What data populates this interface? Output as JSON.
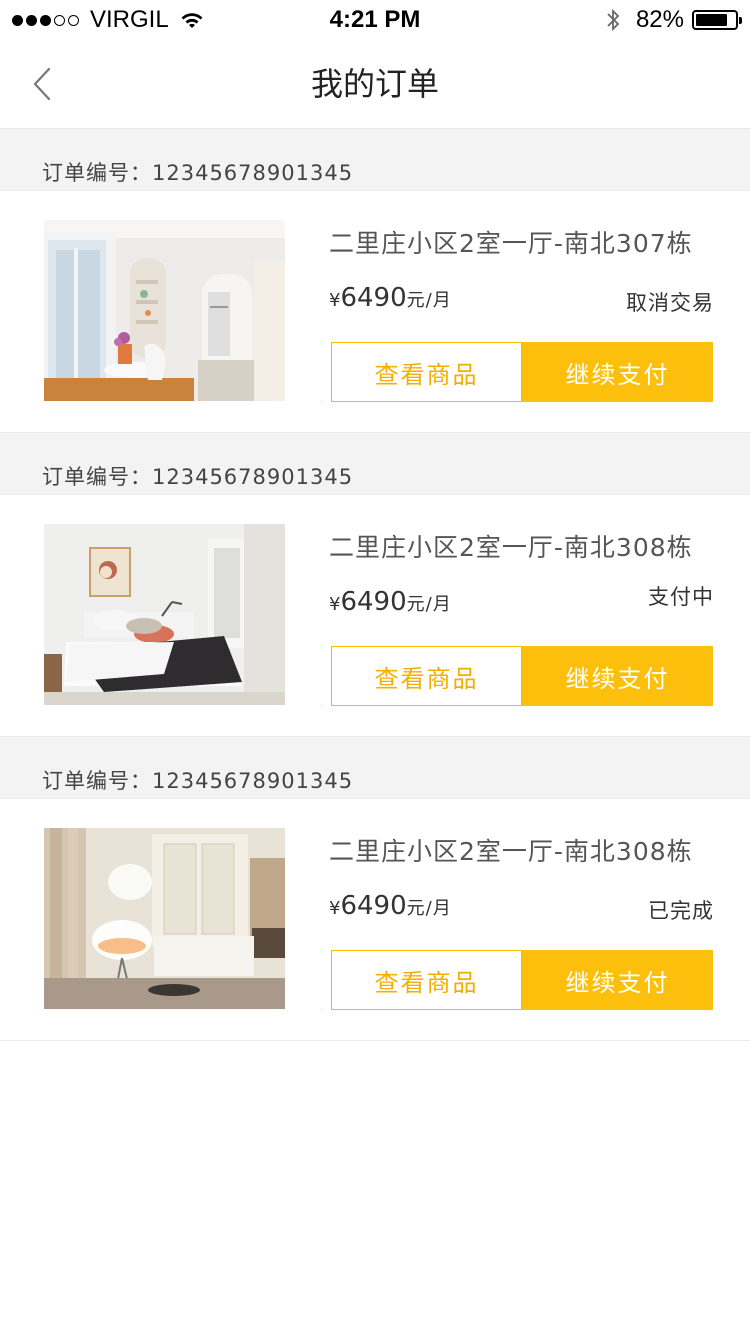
{
  "status_bar": {
    "carrier": "VIRGIL",
    "time": "4:21 PM",
    "battery": "82%",
    "battery_level": 0.82,
    "signal_bars_filled": 3,
    "signal_bars_total": 5
  },
  "nav": {
    "title": "我的订单",
    "back_icon": "chevron-left-icon"
  },
  "colors": {
    "accent": "#fbbf0c",
    "accent_text": "#f3ae00",
    "section_bg": "#f3f3f3"
  },
  "orders": [
    {
      "header": "订单编号：12345678901345",
      "title": "二里庄小区2室一厅-南北307栋",
      "currency": "¥",
      "price": "6490",
      "unit": "元/月",
      "status": "取消交易",
      "view_label": "查看商品",
      "pay_label": "继续支付",
      "image": "living-room-photo"
    },
    {
      "header": "订单编号：12345678901345",
      "title": "二里庄小区2室一厅-南北308栋",
      "currency": "¥",
      "price": "6490",
      "unit": "元/月",
      "status": "支付中",
      "view_label": "查看商品",
      "pay_label": "继续支付",
      "image": "bedroom-photo"
    },
    {
      "header": "订单编号：12345678901345",
      "title": "二里庄小区2室一厅-南北308栋",
      "currency": "¥",
      "price": "6490",
      "unit": "元/月",
      "status": "已完成",
      "view_label": "查看商品",
      "pay_label": "继续支付",
      "image": "lounge-photo"
    }
  ]
}
